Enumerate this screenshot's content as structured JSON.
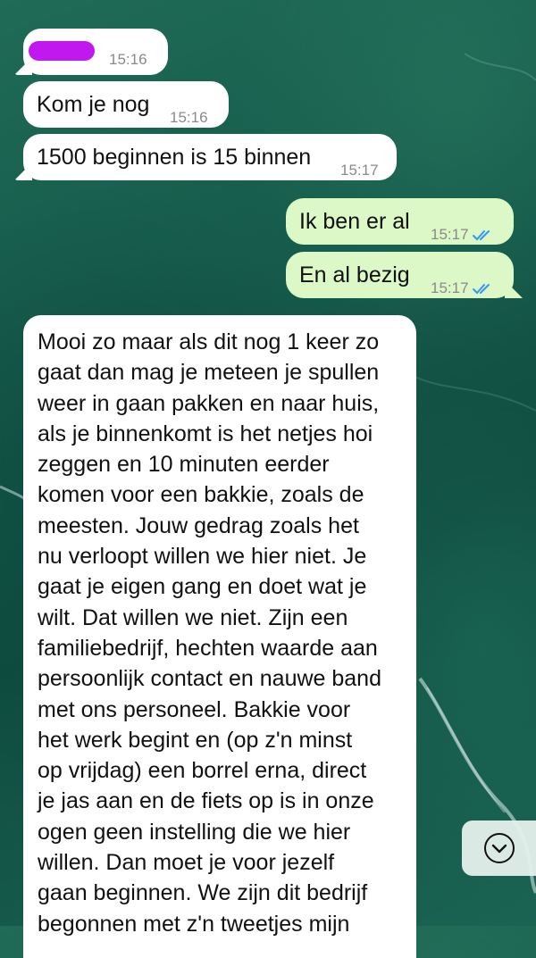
{
  "messages": [
    {
      "direction": "incoming",
      "text": "",
      "redacted": true,
      "time": "15:16"
    },
    {
      "direction": "incoming",
      "text": "Kom je nog",
      "time": "15:16"
    },
    {
      "direction": "incoming",
      "text": "1500 beginnen is 15 binnen",
      "time": "15:17"
    },
    {
      "direction": "outgoing",
      "text": "Ik ben er al",
      "time": "15:17",
      "status": "read"
    },
    {
      "direction": "outgoing",
      "text": "En al bezig",
      "time": "15:17",
      "status": "read"
    },
    {
      "direction": "incoming",
      "text": "Mooi zo maar als dit nog 1 keer zo\ngaat dan mag je meteen je spullen\nweer in gaan pakken en naar huis,\nals je binnenkomt is het netjes hoi\nzeggen en 10 minuten eerder\nkomen voor een bakkie, zoals de\nmeesten. Jouw gedrag zoals het\nnu verloopt willen we hier niet. Je\ngaat je eigen gang en doet wat je\nwilt. Dat willen we niet. Zijn een\nfamiliebedrijf, hechten waarde aan\npersoonlijk contact en nauwe band\nmet ons personeel. Bakkie voor\nhet werk begint en (op z'n minst\nop vrijdag) een borrel erna, direct\nje jas aan en de fiets op is in onze\nogen geen instelling die we hier\nwillen. Dan moet je voor jezelf\ngaan beginnen. We zijn dit bedrijf\nbegonnen met z'n tweetjes mijn"
    }
  ],
  "colors": {
    "incoming_bubble": "#ffffff",
    "outgoing_bubble": "#dcf8c6",
    "read_ticks": "#3497f9",
    "redaction": "#c218f0"
  },
  "icons": {
    "read_status": "double-check-icon",
    "scroll_down": "chevron-down-circle-icon"
  }
}
